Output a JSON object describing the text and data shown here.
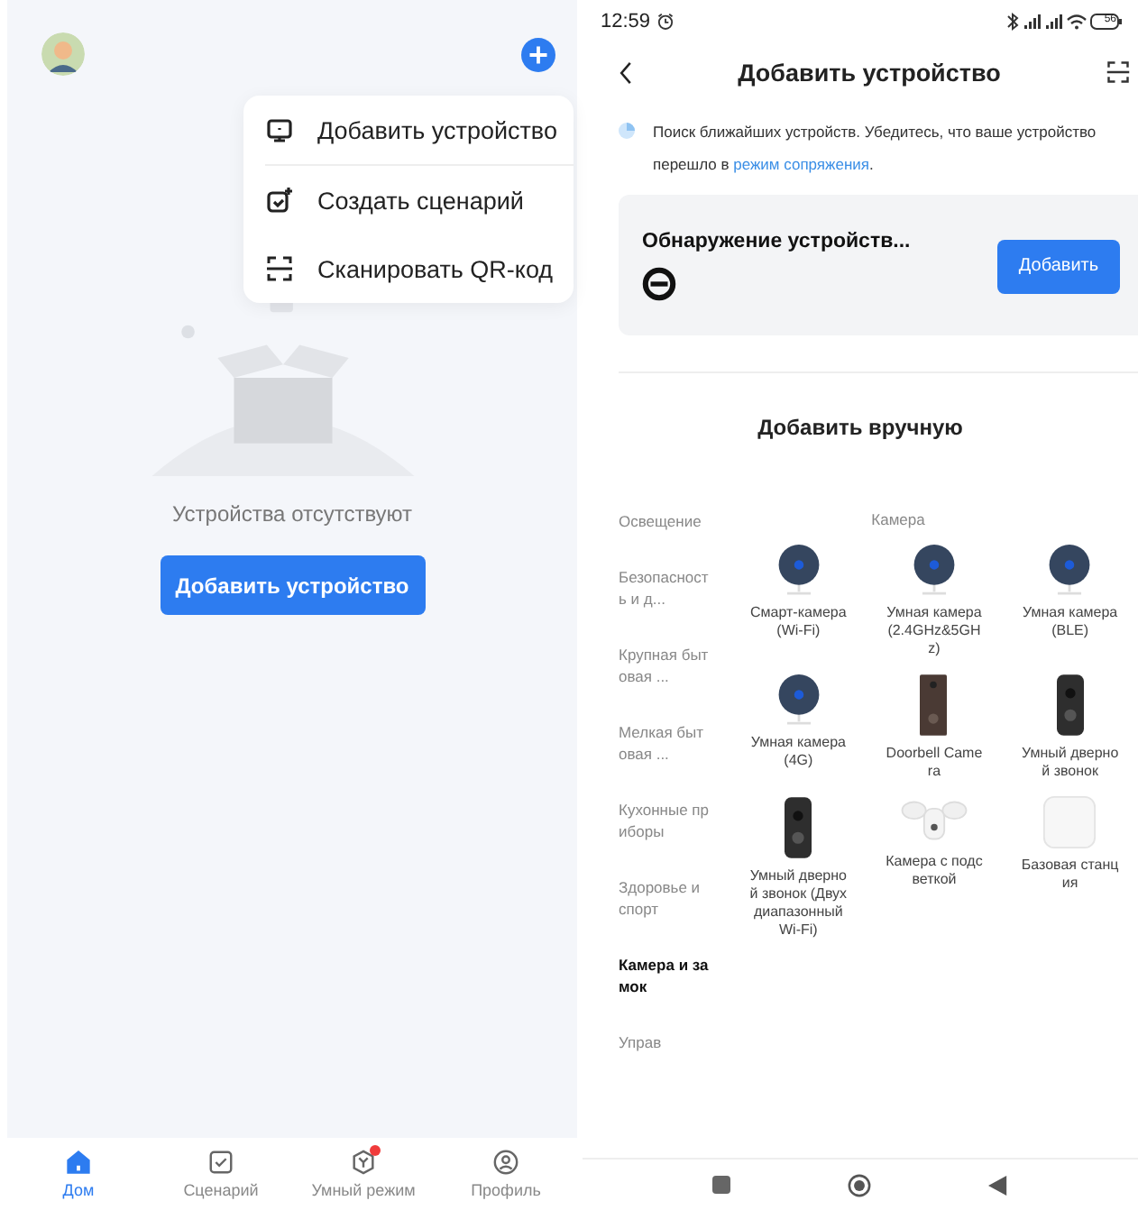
{
  "home": {
    "menu": [
      {
        "kind": "device",
        "label": "Добавить устройство"
      },
      {
        "kind": "scene",
        "label": "Создать сценарий"
      },
      {
        "kind": "scan",
        "label": "Сканировать QR-код"
      }
    ],
    "empty_text": "Устройства отсутствуют",
    "add_button": "Добавить устройство",
    "tabs": [
      {
        "kind": "home",
        "label": "Дом",
        "selected": true,
        "badge": false
      },
      {
        "kind": "scene",
        "label": "Сценарий",
        "selected": false,
        "badge": false
      },
      {
        "kind": "smart",
        "label": "Умный режим",
        "selected": false,
        "badge": true
      },
      {
        "kind": "profile",
        "label": "Профиль",
        "selected": false,
        "badge": false
      }
    ]
  },
  "add_device": {
    "status_bar": {
      "time": "12:59",
      "battery": "56"
    },
    "title": "Добавить устройство",
    "notice": {
      "text": "Поиск ближайших устройств. Убедитесь, что ваше устройство перешло в ",
      "link": "режим сопряжения",
      "end": "."
    },
    "discovery": {
      "title": "Обнаружение устройств...",
      "button": "Добавить"
    },
    "manual_title": "Добавить вручную",
    "categories": [
      {
        "label": "Освещение",
        "selected": false
      },
      {
        "label": "Безопасность и д...",
        "selected": false
      },
      {
        "label": "Крупная бытовая ...",
        "selected": false
      },
      {
        "label": "Мелкая бытовая ...",
        "selected": false
      },
      {
        "label": "Кухонные приборы",
        "selected": false
      },
      {
        "label": "Здоровье и спорт",
        "selected": false
      },
      {
        "label": "Камера и замок",
        "selected": true
      },
      {
        "label": "Управ",
        "selected": false
      }
    ],
    "section_title": "Камера",
    "devices": [
      {
        "kind": "dome",
        "name": "Смарт-камера (Wi-Fi)"
      },
      {
        "kind": "dome",
        "name": "Умная камера (2.4GHz&5GHz)"
      },
      {
        "kind": "dome",
        "name": "Умная камера (BLE)"
      },
      {
        "kind": "dome",
        "name": "Умная камера (4G)"
      },
      {
        "kind": "doorbell_wood",
        "name": "Doorbell Camera"
      },
      {
        "kind": "doorbell",
        "name": "Умный дверной звонок"
      },
      {
        "kind": "doorbell",
        "name": "Умный дверной звонок (Двухдиапазонный Wi-Fi)"
      },
      {
        "kind": "floodlight",
        "name": "Камера с подсветкой"
      },
      {
        "kind": "hub",
        "name": "Базовая станция"
      }
    ]
  }
}
